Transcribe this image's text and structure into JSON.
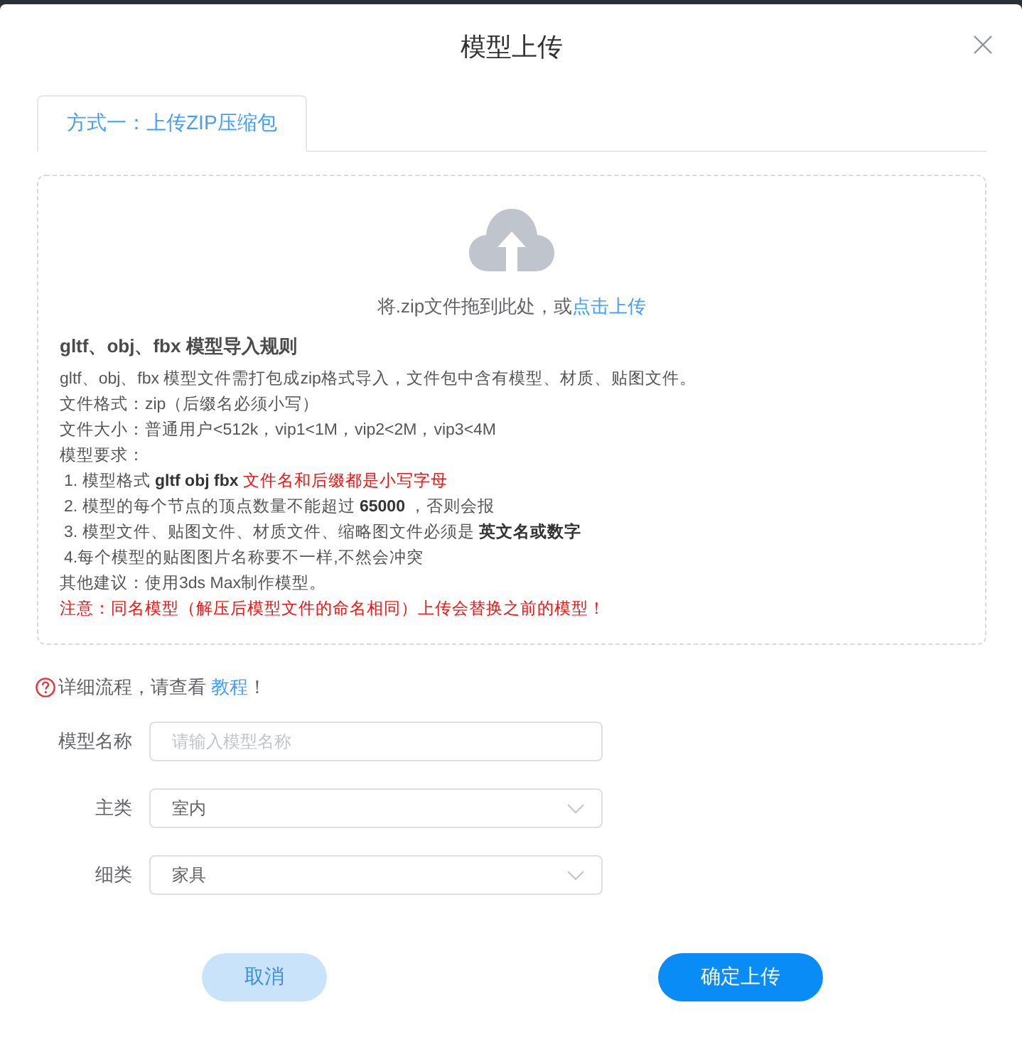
{
  "dialog": {
    "title": "模型上传"
  },
  "tabs": [
    {
      "label": "方式一：上传ZIP压缩包",
      "selected": true
    }
  ],
  "upload": {
    "prompt": "将.zip文件拖到此处，或",
    "link": "点击上传"
  },
  "rules": {
    "heading": "gltf、obj、fbx 模型导入规则",
    "lines": [
      {
        "kind": "plain",
        "text": "gltf、obj、fbx 模型文件需打包成zip格式导入，文件包中含有模型、材质、贴图文件。"
      },
      {
        "kind": "plain",
        "text": "文件格式：zip（后缀名必须小写）"
      },
      {
        "kind": "plain",
        "text": "文件大小：普通用户<512k，vip1<1M，vip2<2M，vip3<4M"
      },
      {
        "kind": "plain",
        "text": "模型要求："
      },
      {
        "kind": "item",
        "text": "1. 模型格式 **gltf obj fbx** ",
        "note": "文件名和后缀都是小写字母"
      },
      {
        "kind": "item",
        "text": "2. 模型的每个节点的顶点数量不能超过 **65000** ，否则会报"
      },
      {
        "kind": "item",
        "text": "3. 模型文件、贴图文件、材质文件、缩略图文件必须是 **英文名或数字**"
      },
      {
        "kind": "item",
        "text": "4.每个模型的贴图图片名称要不一样,不然会冲突"
      },
      {
        "kind": "plain",
        "text": "其他建议：使用3ds Max制作模型。"
      },
      {
        "kind": "warning",
        "text": "注意：同名模型（解压后模型文件的命名相同）上传会替换之前的模型！"
      }
    ]
  },
  "help": {
    "text": "详细流程，请查看 ",
    "link": "教程",
    "suffix": "！"
  },
  "form": [
    {
      "label": "模型名称",
      "kind": "text",
      "placeholder": "请输入模型名称"
    },
    {
      "label": "主类",
      "kind": "select",
      "value": "室内"
    },
    {
      "label": "细类",
      "kind": "select",
      "value": "家具"
    }
  ],
  "buttons": [
    {
      "label": "取消",
      "kind": "secondary"
    },
    {
      "label": "确定上传",
      "kind": "primary"
    }
  ]
}
